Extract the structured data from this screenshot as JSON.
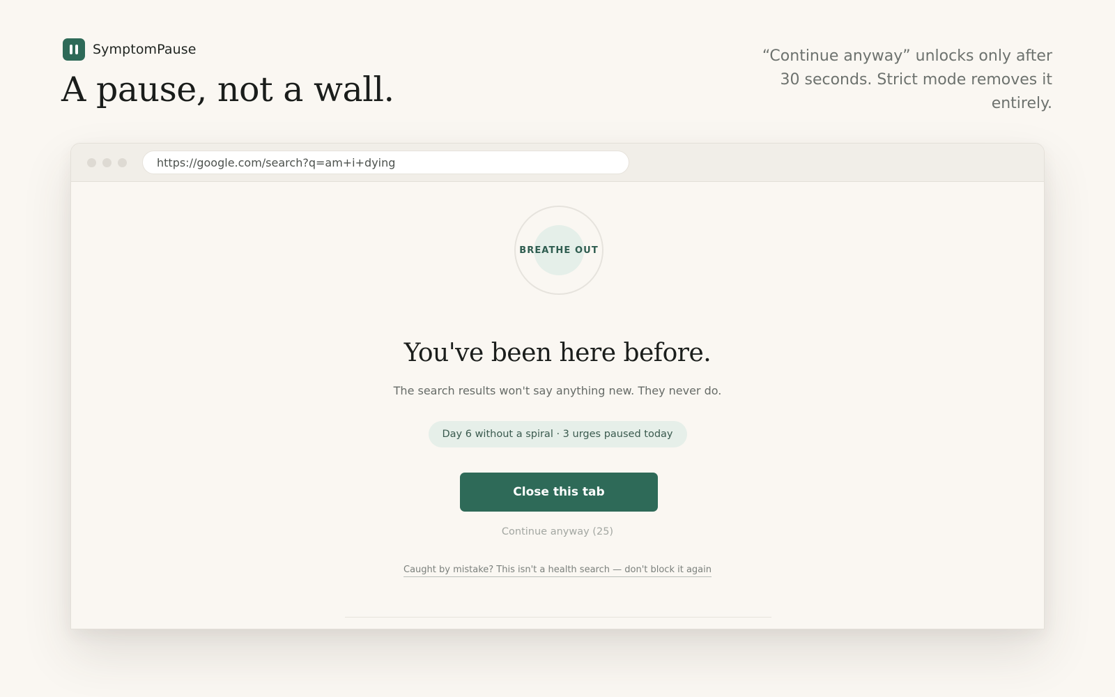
{
  "brand": {
    "name": "SymptomPause",
    "logo_icon": "pause-icon",
    "accent_color": "#2e6a58"
  },
  "hero": {
    "headline": "A pause, not a wall.",
    "side_note": "“Continue anyway” unlocks only after 30 seconds. Strict mode removes it entirely."
  },
  "browser": {
    "url": "https://google.com/search?q=am+i+dying"
  },
  "intercept": {
    "breathe_label": "BREATHE OUT",
    "title": "You've been here before.",
    "subtitle": "The search results won't say anything new. They never do.",
    "streak_pill": "Day 6 without a spiral · 3 urges paused today",
    "primary_button": "Close this tab",
    "continue_link": "Continue anyway (25)",
    "mistake_link": "Caught by mistake? This isn't a health search — don't block it again"
  }
}
